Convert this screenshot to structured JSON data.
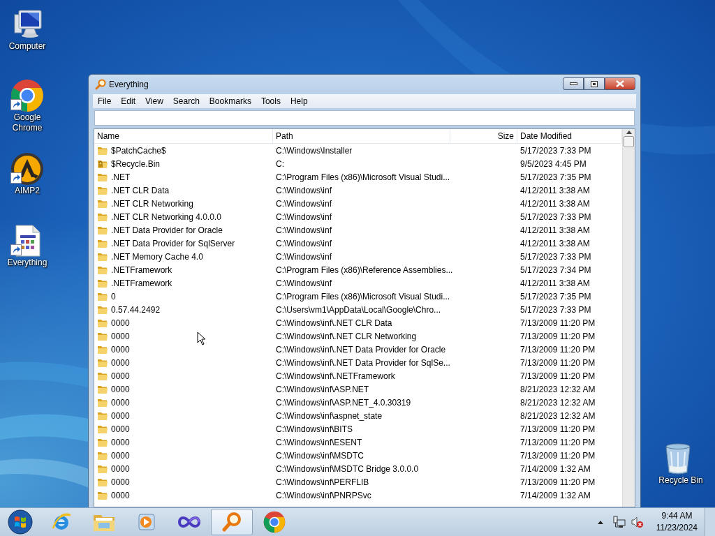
{
  "desktop_icons": [
    {
      "label": "Computer",
      "kind": "computer",
      "shortcut": false
    },
    {
      "label": "Google Chrome",
      "kind": "chrome",
      "shortcut": true
    },
    {
      "label": "AIMP2",
      "kind": "aimp",
      "shortcut": true
    },
    {
      "label": "Everything",
      "kind": "document",
      "shortcut": true
    },
    {
      "label": "Recycle Bin",
      "kind": "recycle-bin",
      "shortcut": false
    }
  ],
  "window": {
    "title": "Everything",
    "menu": [
      "File",
      "Edit",
      "View",
      "Search",
      "Bookmarks",
      "Tools",
      "Help"
    ],
    "table": {
      "columns": [
        "Name",
        "Path",
        "Size",
        "Date Modified"
      ],
      "rows": [
        {
          "kind": "folder",
          "name": "$PatchCache$",
          "path": "C:\\Windows\\Installer",
          "date": "5/17/2023 7:33 PM"
        },
        {
          "kind": "locked-folder",
          "name": "$Recycle.Bin",
          "path": "C:",
          "date": "9/5/2023 4:45 PM"
        },
        {
          "kind": "folder",
          "name": ".NET",
          "path": "C:\\Program Files (x86)\\Microsoft Visual Studi...",
          "date": "5/17/2023 7:35 PM"
        },
        {
          "kind": "folder",
          "name": ".NET CLR Data",
          "path": "C:\\Windows\\inf",
          "date": "4/12/2011 3:38 AM"
        },
        {
          "kind": "folder",
          "name": ".NET CLR Networking",
          "path": "C:\\Windows\\inf",
          "date": "4/12/2011 3:38 AM"
        },
        {
          "kind": "folder",
          "name": ".NET CLR Networking 4.0.0.0",
          "path": "C:\\Windows\\inf",
          "date": "5/17/2023 7:33 PM"
        },
        {
          "kind": "folder",
          "name": ".NET Data Provider for Oracle",
          "path": "C:\\Windows\\inf",
          "date": "4/12/2011 3:38 AM"
        },
        {
          "kind": "folder",
          "name": ".NET Data Provider for SqlServer",
          "path": "C:\\Windows\\inf",
          "date": "4/12/2011 3:38 AM"
        },
        {
          "kind": "folder",
          "name": ".NET Memory Cache 4.0",
          "path": "C:\\Windows\\inf",
          "date": "5/17/2023 7:33 PM"
        },
        {
          "kind": "folder",
          "name": ".NETFramework",
          "path": "C:\\Program Files (x86)\\Reference Assemblies...",
          "date": "5/17/2023 7:34 PM"
        },
        {
          "kind": "folder",
          "name": ".NETFramework",
          "path": "C:\\Windows\\inf",
          "date": "4/12/2011 3:38 AM"
        },
        {
          "kind": "folder",
          "name": "0",
          "path": "C:\\Program Files (x86)\\Microsoft Visual Studi...",
          "date": "5/17/2023 7:35 PM"
        },
        {
          "kind": "folder",
          "name": "0.57.44.2492",
          "path": "C:\\Users\\vm1\\AppData\\Local\\Google\\Chro...",
          "date": "5/17/2023 7:33 PM"
        },
        {
          "kind": "folder",
          "name": "0000",
          "path": "C:\\Windows\\inf\\.NET CLR Data",
          "date": "7/13/2009 11:20 PM"
        },
        {
          "kind": "folder",
          "name": "0000",
          "path": "C:\\Windows\\inf\\.NET CLR Networking",
          "date": "7/13/2009 11:20 PM"
        },
        {
          "kind": "folder",
          "name": "0000",
          "path": "C:\\Windows\\inf\\.NET Data Provider for Oracle",
          "date": "7/13/2009 11:20 PM"
        },
        {
          "kind": "folder",
          "name": "0000",
          "path": "C:\\Windows\\inf\\.NET Data Provider for SqlSe...",
          "date": "7/13/2009 11:20 PM"
        },
        {
          "kind": "folder",
          "name": "0000",
          "path": "C:\\Windows\\inf\\.NETFramework",
          "date": "7/13/2009 11:20 PM"
        },
        {
          "kind": "folder",
          "name": "0000",
          "path": "C:\\Windows\\inf\\ASP.NET",
          "date": "8/21/2023 12:32 AM"
        },
        {
          "kind": "folder",
          "name": "0000",
          "path": "C:\\Windows\\inf\\ASP.NET_4.0.30319",
          "date": "8/21/2023 12:32 AM"
        },
        {
          "kind": "folder",
          "name": "0000",
          "path": "C:\\Windows\\inf\\aspnet_state",
          "date": "8/21/2023 12:32 AM"
        },
        {
          "kind": "folder",
          "name": "0000",
          "path": "C:\\Windows\\inf\\BITS",
          "date": "7/13/2009 11:20 PM"
        },
        {
          "kind": "folder",
          "name": "0000",
          "path": "C:\\Windows\\inf\\ESENT",
          "date": "7/13/2009 11:20 PM"
        },
        {
          "kind": "folder",
          "name": "0000",
          "path": "C:\\Windows\\inf\\MSDTC",
          "date": "7/13/2009 11:20 PM"
        },
        {
          "kind": "folder",
          "name": "0000",
          "path": "C:\\Windows\\inf\\MSDTC Bridge 3.0.0.0",
          "date": "7/14/2009 1:32 AM"
        },
        {
          "kind": "folder",
          "name": "0000",
          "path": "C:\\Windows\\inf\\PERFLIB",
          "date": "7/13/2009 11:20 PM"
        },
        {
          "kind": "folder",
          "name": "0000",
          "path": "C:\\Windows\\inf\\PNRPSvc",
          "date": "7/14/2009 1:32 AM"
        }
      ]
    }
  },
  "taskbar": {
    "items": [
      {
        "kind": "ie",
        "selected": false
      },
      {
        "kind": "explorer",
        "selected": false
      },
      {
        "kind": "media",
        "selected": false
      },
      {
        "kind": "infinity",
        "selected": false
      },
      {
        "kind": "everything",
        "selected": true
      },
      {
        "kind": "chrome",
        "selected": false
      }
    ],
    "clock": {
      "time": "9:44 AM",
      "date": "11/23/2024"
    }
  }
}
